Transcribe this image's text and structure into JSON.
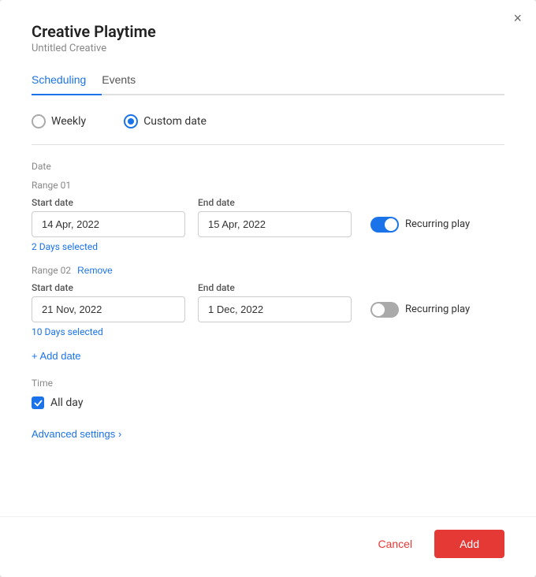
{
  "modal": {
    "title": "Creative Playtime",
    "subtitle": "Untitled Creative",
    "close_icon": "×"
  },
  "tabs": {
    "scheduling_label": "Scheduling",
    "events_label": "Events",
    "active": "scheduling"
  },
  "radio_options": {
    "weekly_label": "Weekly",
    "custom_date_label": "Custom date",
    "selected": "custom_date"
  },
  "date_section_label": "Date",
  "ranges": [
    {
      "id": "Range 01",
      "start_label": "Start date",
      "start_value": "14 Apr, 2022",
      "end_label": "End date",
      "end_value": "15 Apr, 2022",
      "days_selected": "2 Days selected",
      "recurring_on": true,
      "recurring_label": "Recurring play",
      "has_remove": false
    },
    {
      "id": "Range 02",
      "start_label": "Start date",
      "start_value": "21 Nov, 2022",
      "end_label": "End date",
      "end_value": "1 Dec, 2022",
      "days_selected": "10 Days selected",
      "recurring_on": false,
      "recurring_label": "Recurring play",
      "has_remove": true,
      "remove_label": "Remove"
    }
  ],
  "add_date_label": "+ Add date",
  "time_section_label": "Time",
  "allday_label": "All day",
  "advanced_settings_label": "Advanced settings ›",
  "footer": {
    "cancel_label": "Cancel",
    "add_label": "Add"
  }
}
